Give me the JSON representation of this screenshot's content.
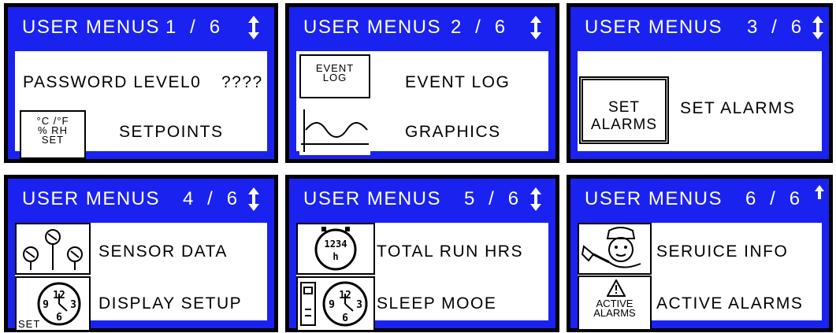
{
  "colors": {
    "screen_bg": "#1a22f0",
    "frame": "#000000",
    "text": "#ffffff",
    "content_bg": "#ffffff"
  },
  "panels": [
    {
      "title": "USER MENUS",
      "page": "1  /  6",
      "arrow": "up-down-arrow-icon",
      "items": [
        {
          "label": "PASSWORD LEVEL0",
          "value": "????"
        },
        {
          "icon_lines": [
            "°C /°F",
            "% RH",
            "SET"
          ],
          "label": "SETPOINTS"
        }
      ]
    },
    {
      "title": "USER MENUS",
      "page": "2  /  6",
      "arrow": "up-down-arrow-icon",
      "items": [
        {
          "icon_lines": [
            "EVENT",
            "LOG"
          ],
          "label": "EVENT LOG"
        },
        {
          "icon": "graph-wave-icon",
          "label": "GRAPHICS"
        }
      ]
    },
    {
      "title": "USER MENUS",
      "page": "3  /  6",
      "arrow": "up-down-arrow-icon",
      "items": [
        {
          "icon_lines": [
            "SET",
            "ALARMS"
          ],
          "label": "SET ALARMS"
        }
      ]
    },
    {
      "title": "USER MENUS",
      "page": "4  /  6",
      "arrow": "up-down-arrow-icon",
      "items": [
        {
          "icon": "sensors-icon",
          "label": "SENSOR DATA"
        },
        {
          "icon": "clock-set-icon",
          "icon_text": "SET",
          "label": "DISPLAY SETUP"
        }
      ]
    },
    {
      "title": "USER MENUS",
      "page": "5  /  6",
      "arrow": "up-down-arrow-icon",
      "items": [
        {
          "icon": "run-hours-clock-icon",
          "icon_text": "1234",
          "icon_sub": "h",
          "label": "TOTAL RUN HRS"
        },
        {
          "icon": "sleep-clock-icon",
          "label": "SLEEP MOOE"
        }
      ]
    },
    {
      "title": "USER MENUS",
      "page": "6  /  6",
      "arrow": "up-arrow-icon",
      "items": [
        {
          "icon": "service-technician-icon",
          "label": "SERUICE INFO"
        },
        {
          "icon": "warning-triangle-icon",
          "icon_lines": [
            "ACTIVE",
            "ALARMS"
          ],
          "label": "ACTIVE ALARMS"
        }
      ]
    }
  ]
}
